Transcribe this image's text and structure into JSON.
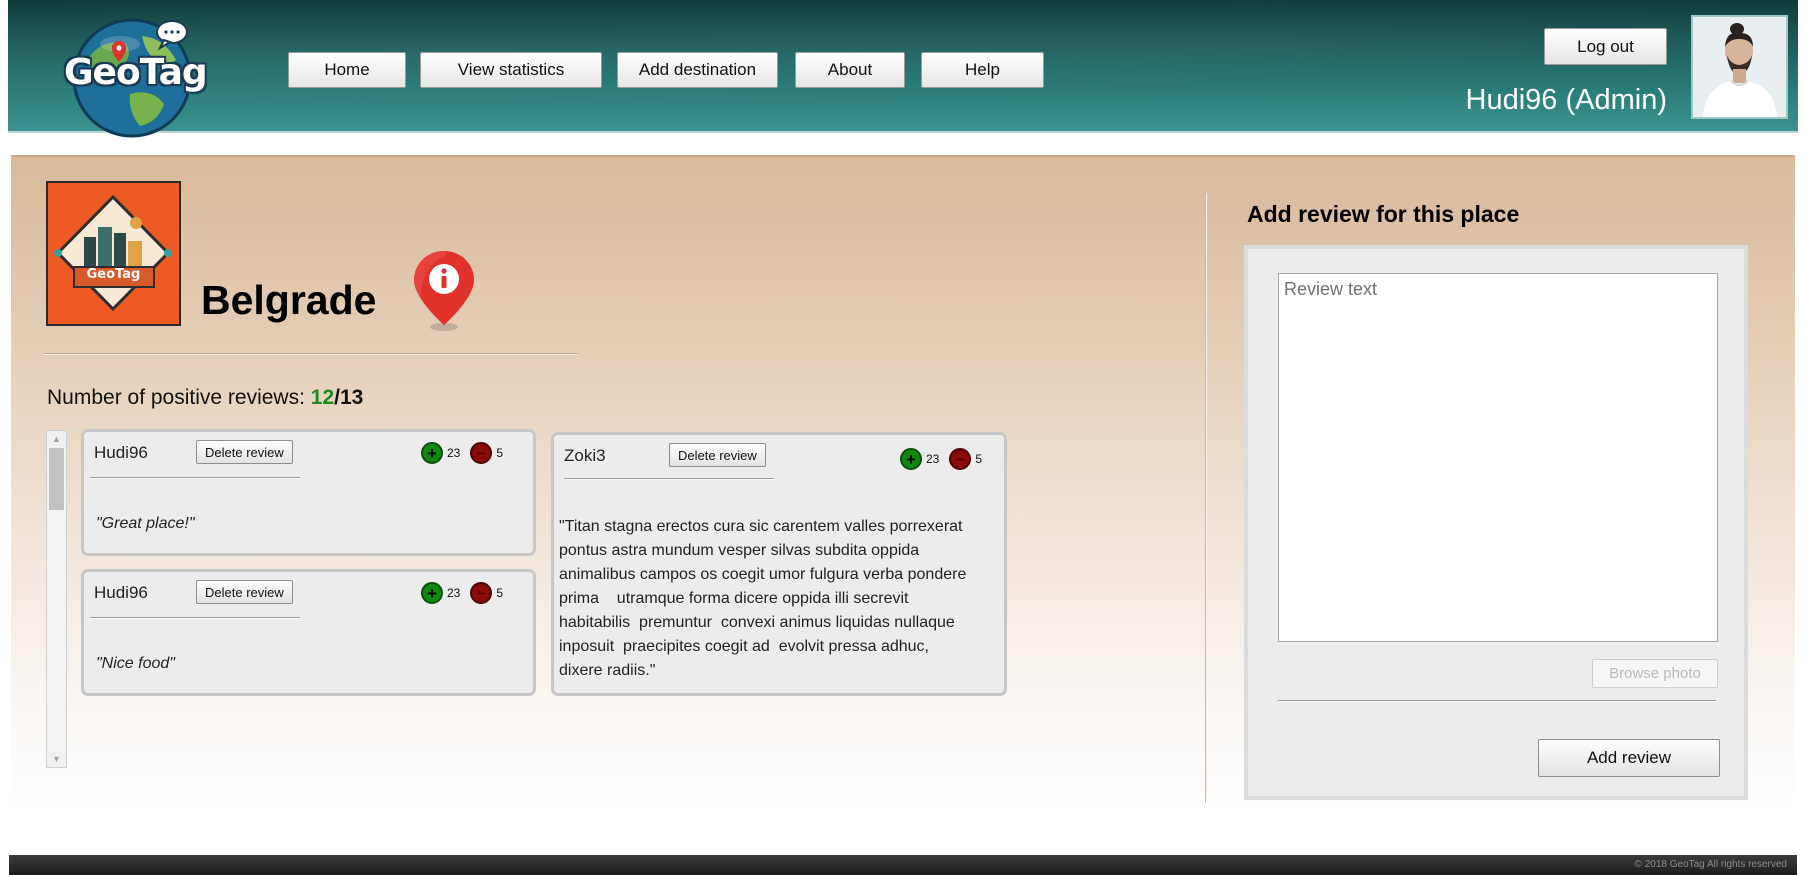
{
  "app": {
    "logo_text": "GeoTag"
  },
  "nav": {
    "items": [
      {
        "label": "Home"
      },
      {
        "label": "View statistics"
      },
      {
        "label": "Add destination"
      },
      {
        "label": "About"
      },
      {
        "label": "Help"
      }
    ]
  },
  "user": {
    "logout_label": "Log out",
    "display_name": "Hudi96 (Admin)"
  },
  "place": {
    "name": "Belgrade",
    "logo_text": "GeoTag",
    "positive_label": "Number of positive reviews: ",
    "positive_count": "12",
    "separator": "/",
    "total_count": "13"
  },
  "reviews": [
    {
      "author": "Hudi96",
      "delete_label": "Delete review",
      "upvotes": "23",
      "downvotes": "5",
      "text": "\"Great place!\""
    },
    {
      "author": "Hudi96",
      "delete_label": "Delete review",
      "upvotes": "23",
      "downvotes": "5",
      "text": "\"Nice food\""
    },
    {
      "author": "Zoki3",
      "delete_label": "Delete review",
      "upvotes": "23",
      "downvotes": "5",
      "text_lines": [
        "\"Titan stagna erectos cura sic carentem valles porrexerat",
        "pontus astra mundum vesper silvas subdita oppida",
        "animalibus  campos os coegit umor fulgura verba pondere",
        "prima    utramque forma dicere oppida illi secrevit",
        "habitabilis  premuntur  convexi animus liquidas nullaque",
        "inposuit  praecipites coegit ad  evolvit pressa adhuc,",
        "dixere radiis.\""
      ]
    }
  ],
  "add_review": {
    "title": "Add review for this place",
    "placeholder": "Review text",
    "browse_label": "Browse photo",
    "submit_label": "Add review"
  },
  "footer": {
    "copyright": "© 2018 GeoTag All rights reserved"
  },
  "colors": {
    "header": "#1c5c5a",
    "positive": "#1d8c1d",
    "upvote": "#0f8a0f",
    "downvote": "#8b0a0a",
    "pin": "#e0312a"
  }
}
